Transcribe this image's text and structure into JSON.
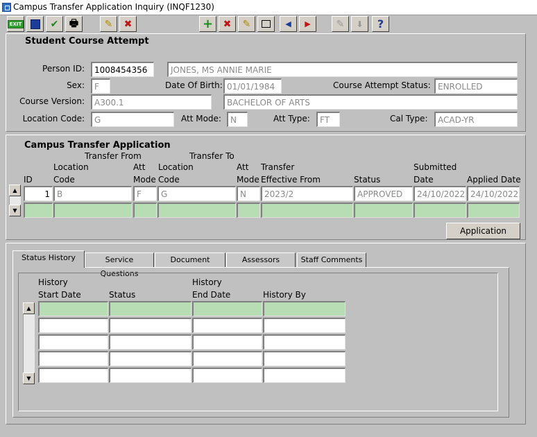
{
  "window": {
    "title": "Campus Transfer Application Inquiry (INQF1230)"
  },
  "toolbar": {
    "exit_label": "EXIT",
    "help_label": "?"
  },
  "attempt": {
    "section_title": "Student Course Attempt",
    "person_id_label": "Person ID:",
    "person_id": "1008454356",
    "person_name": "JONES,  MS  ANNIE MARIE",
    "sex_label": "Sex:",
    "sex": "F",
    "dob_label": "Date Of Birth:",
    "dob": "01/01/1984",
    "status_label": "Course Attempt Status:",
    "status": "ENROLLED",
    "course_version_label": "Course Version:",
    "course_version": "A300.1",
    "course_title": "BACHELOR OF ARTS",
    "location_label": "Location Code:",
    "location": "G",
    "att_mode_label": "Att Mode:",
    "att_mode": "N",
    "att_type_label": "Att Type:",
    "att_type": "FT",
    "cal_type_label": "Cal Type:",
    "cal_type": "ACAD-YR"
  },
  "transfer": {
    "section_title": "Campus Transfer Application",
    "group_from": "Transfer From",
    "group_to": "Transfer To",
    "headers": {
      "id": "ID",
      "from_loc_1": "Location",
      "from_loc_2": "Code",
      "from_mode_1": "Att",
      "from_mode_2": "Mode",
      "to_loc_1": "Location",
      "to_loc_2": "Code",
      "to_mode_1": "Att",
      "to_mode_2": "Mode",
      "eff_1": "Transfer",
      "eff_2": "Effective From",
      "status": "Status",
      "sub_1": "Submitted",
      "sub_2": "Date",
      "applied": "Applied Date"
    },
    "row": {
      "id": "1",
      "from_loc": "B",
      "from_mode": "F",
      "to_loc": "G",
      "to_mode": "N",
      "effective": "2023/2",
      "status": "APPROVED",
      "submitted": "24/10/2022",
      "applied": "24/10/2022"
    },
    "application_button": "Application"
  },
  "tabs": [
    "Status History",
    "Service Questions",
    "Document",
    "Assessors",
    "Staff Comments"
  ],
  "history": {
    "h_start_1": "History",
    "h_start_2": "Start Date",
    "h_status": "Status",
    "h_end_1": "History",
    "h_end_2": "End Date",
    "h_by": "History By"
  }
}
